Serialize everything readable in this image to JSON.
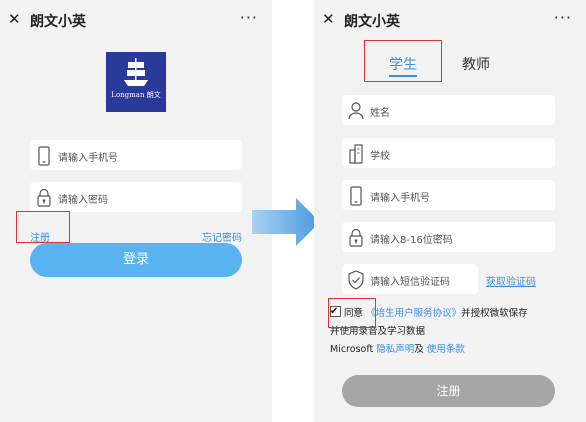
{
  "left": {
    "title": "朗文小英",
    "more": "···",
    "close": "✕",
    "logo_text": "Longman 朗文",
    "phone_placeholder": "请输入手机号",
    "password_placeholder": "请输入密码",
    "register_link": "注册",
    "forgot_link": "忘记密码",
    "login_button": "登录"
  },
  "right": {
    "title": "朗文小英",
    "more": "···",
    "close": "✕",
    "tabs": {
      "student": "学生",
      "teacher": "教师"
    },
    "name_placeholder": "姓名",
    "school_placeholder": "学校",
    "phone_placeholder": "请输入手机号",
    "password_placeholder": "请输入8-16位密码",
    "code_placeholder": "请输入短信验证码",
    "get_code_link": "获取验证码",
    "agree_prefix": "同意",
    "agreement_link": "《培生用户服务协议》",
    "agree_mid": "并授权微软保存",
    "agree_line2": "并使用录音及学习数据",
    "agree_ms": "Microsoft",
    "privacy_link": "隐私声明",
    "and": "及",
    "terms_link": "使用条款",
    "register_button": "注册"
  },
  "colors": {
    "accent": "#3a8ee6",
    "login_button": "#58b3f0",
    "register_button": "#a6a6a6",
    "highlight": "#dd3333",
    "arrow": "#5ea8e6"
  }
}
